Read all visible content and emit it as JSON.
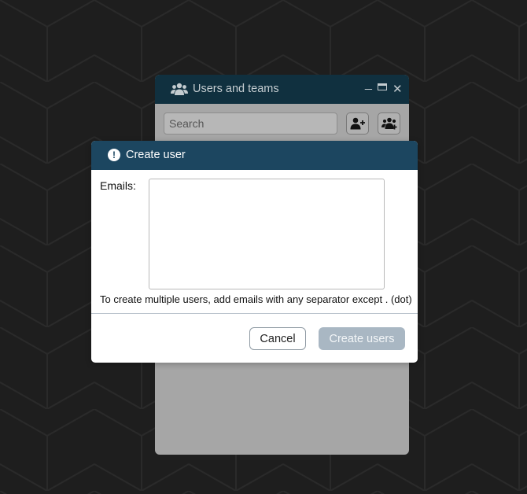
{
  "background_window": {
    "title": "Users and teams",
    "title_icon": "users-icon",
    "controls": {
      "minimize": "_",
      "close": "✕"
    },
    "search_placeholder": "Search",
    "add_user_icon": "add-user-icon",
    "add_team_icon": "add-team-icon"
  },
  "dialog": {
    "title": "Create user",
    "title_icon": "alert-icon",
    "emails_label": "Emails:",
    "emails_value": "",
    "hint": "To create multiple users, add emails with any separator except . (dot)",
    "cancel_label": "Cancel",
    "create_label": "Create users"
  },
  "colors": {
    "desktop_bg": "#1e1e1e",
    "titlebar": "#10303f",
    "dialog_header": "#1c4660",
    "create_disabled": "#a9b7c3"
  }
}
